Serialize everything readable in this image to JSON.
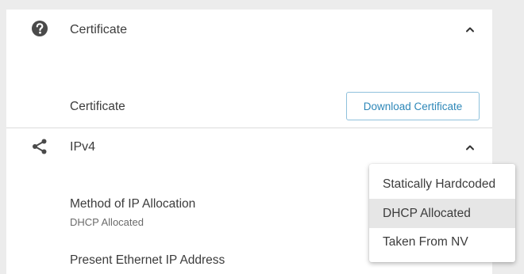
{
  "certificate_section": {
    "title": "Certificate",
    "row_label": "Certificate",
    "download_button": "Download Certificate",
    "header_icon": "question-circle-icon",
    "toggle_icon": "chevron-up-icon"
  },
  "ipv4_section": {
    "title": "IPv4",
    "header_icon": "share-icon",
    "toggle_icon": "chevron-up-icon",
    "method_label": "Method of IP Allocation",
    "method_value": "DHCP Allocated",
    "present_ip_label": "Present Ethernet IP Address"
  },
  "allocation_dropdown": {
    "selected": "DHCP Allocated",
    "options": [
      "Statically Hardcoded",
      "DHCP Allocated",
      "Taken From NV"
    ]
  },
  "colors": {
    "background": "#ececec",
    "card": "#ffffff",
    "accent": "#2d87b8",
    "button_border": "#8fc1dc",
    "selected_option": "#e6e6e6",
    "icon": "#4a4a4a"
  }
}
